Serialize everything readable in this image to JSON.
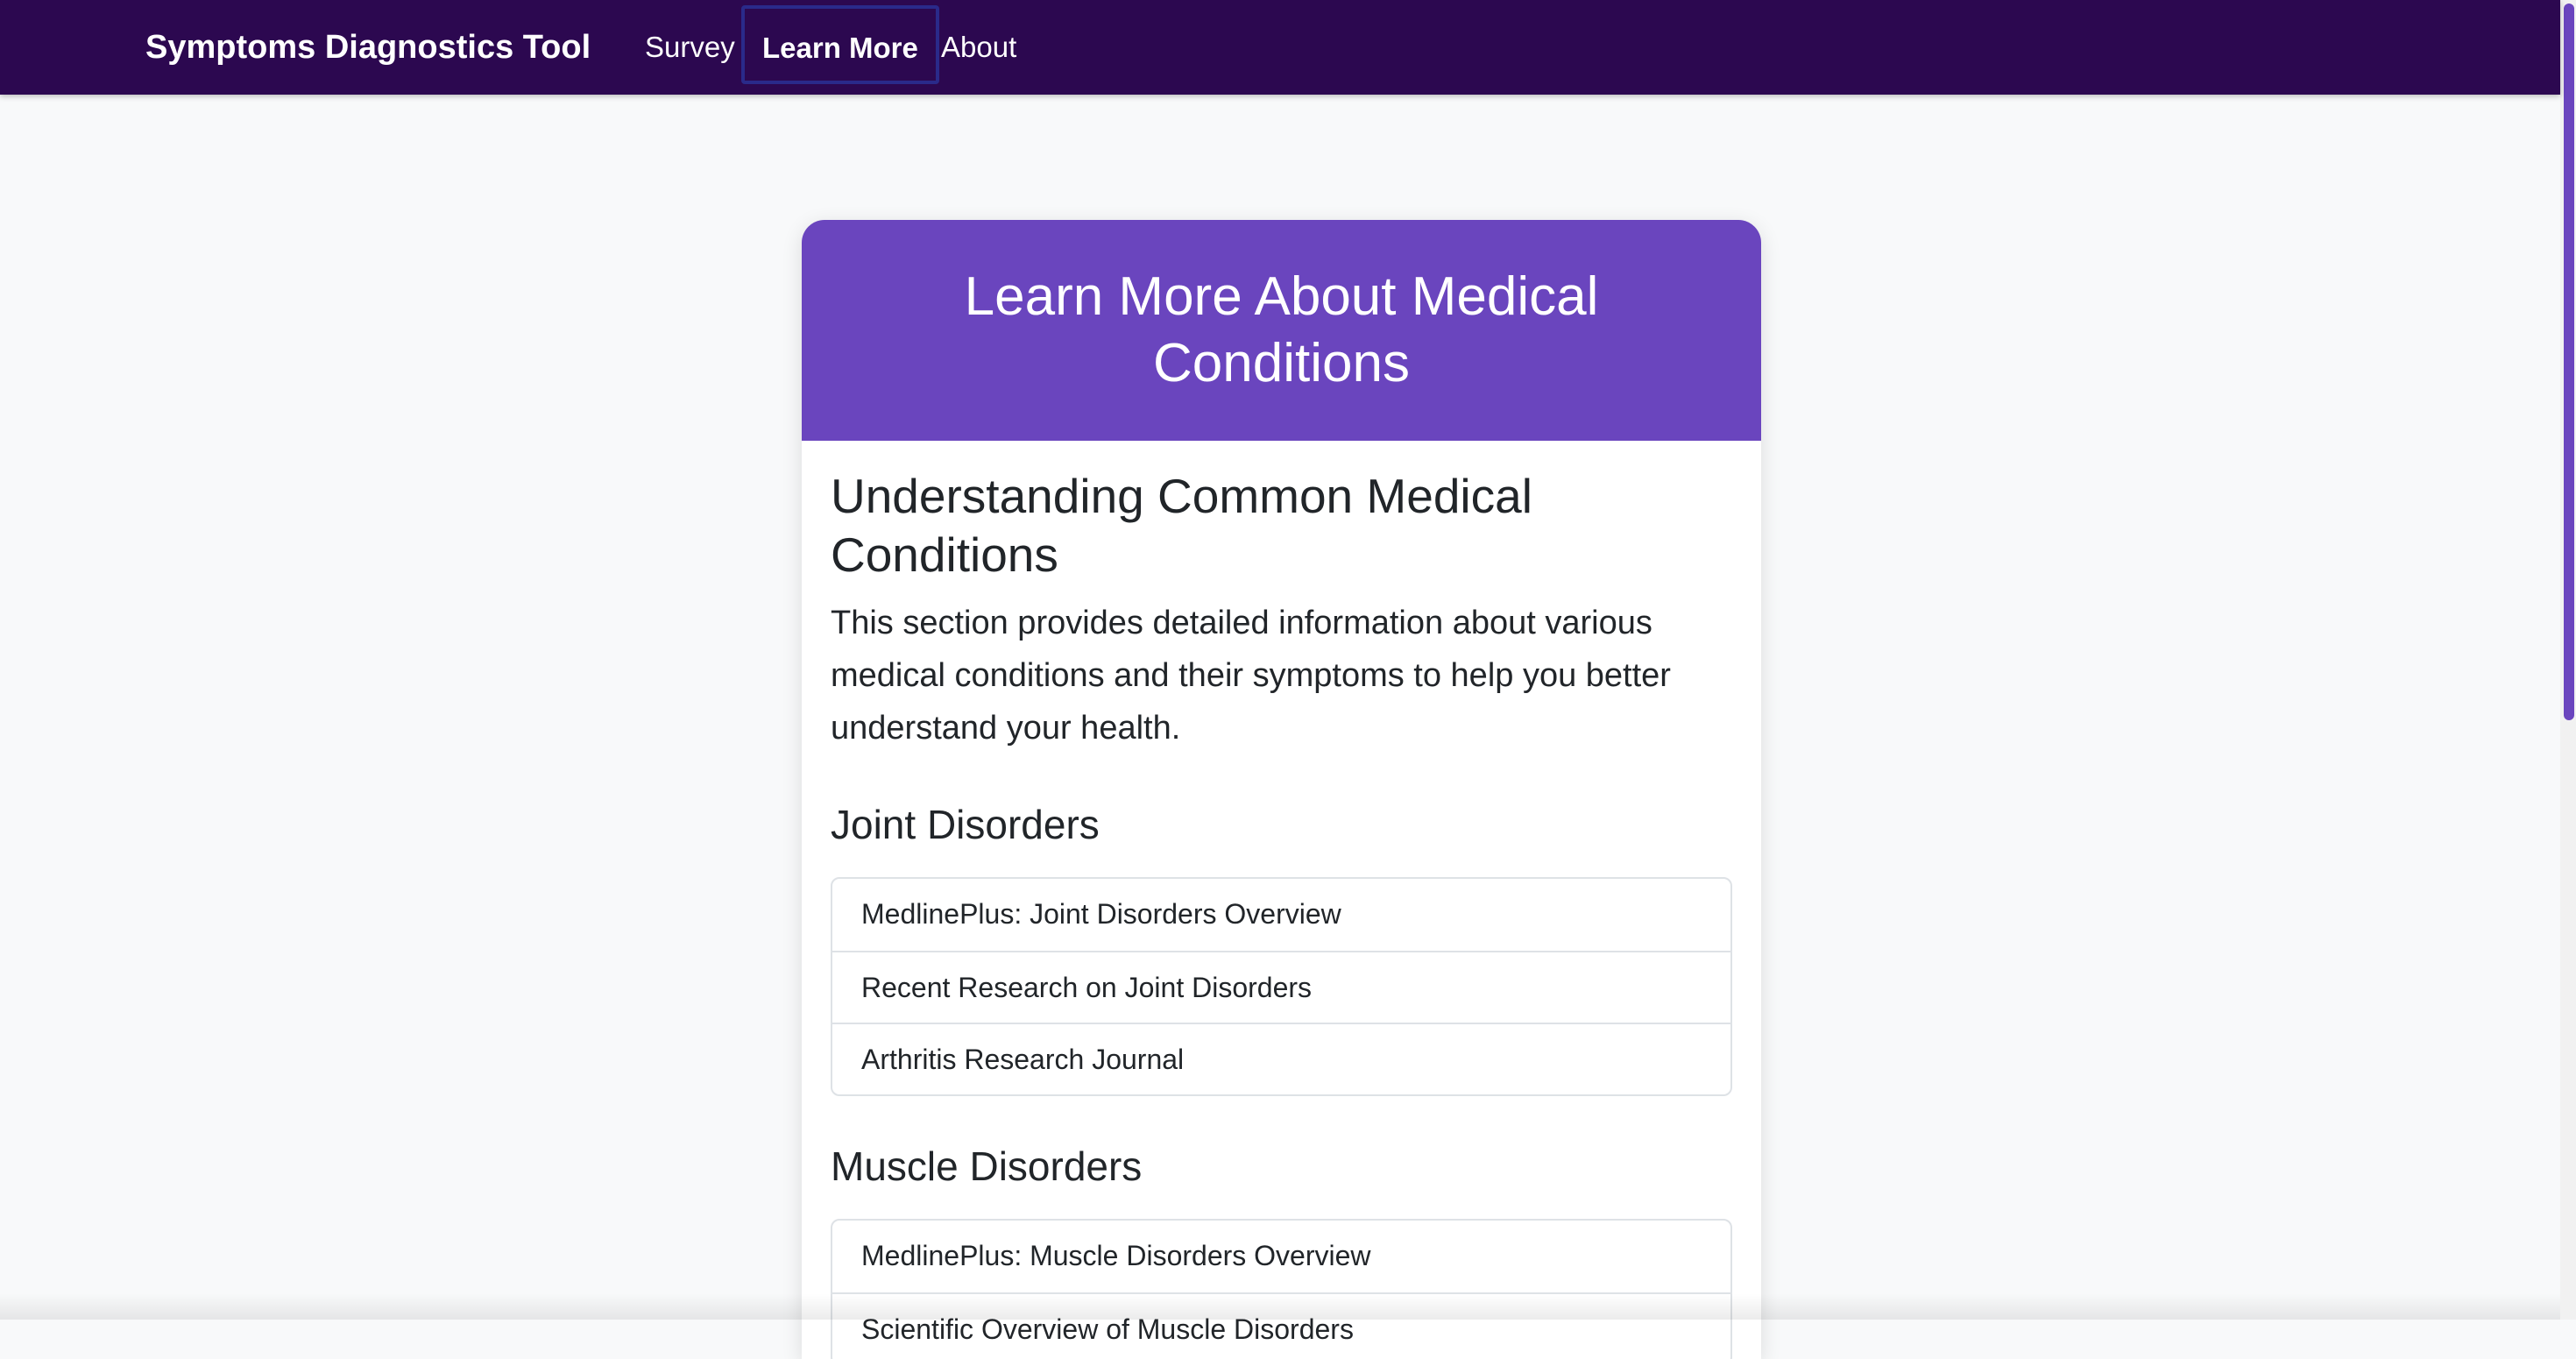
{
  "navbar": {
    "brand": "Symptoms Diagnostics Tool",
    "links": [
      {
        "label": "Survey"
      },
      {
        "label": "Learn More",
        "active": true
      },
      {
        "label": "About"
      }
    ]
  },
  "card": {
    "header_title": "Learn More About Medical Conditions",
    "section_title": "Understanding Common Medical Conditions",
    "intro": "This section provides detailed information about various medical conditions and their symptoms to help you better understand your health.",
    "categories": [
      {
        "title": "Joint Disorders",
        "links": [
          "MedlinePlus: Joint Disorders Overview",
          "Recent Research on Joint Disorders",
          "Arthritis Research Journal"
        ]
      },
      {
        "title": "Muscle Disorders",
        "links": [
          "MedlinePlus: Muscle Disorders Overview",
          "Scientific Overview of Muscle Disorders"
        ]
      }
    ]
  },
  "colors": {
    "navbar_bg": "#2c0850",
    "accent": "#6a45be",
    "page_bg": "#f8f9fa"
  }
}
